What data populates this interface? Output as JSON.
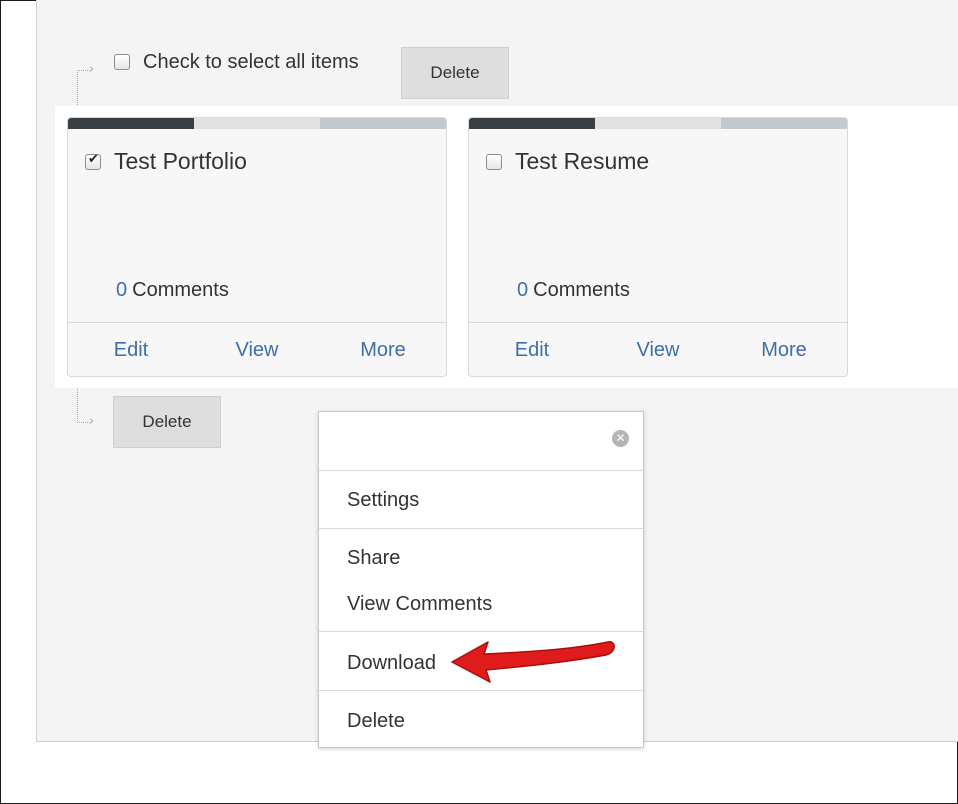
{
  "select_all": {
    "label": "Check to select all items",
    "delete_top": "Delete",
    "delete_bottom": "Delete"
  },
  "cards": [
    {
      "title": "Test Portfolio",
      "checked": true,
      "comment_count": "0",
      "comment_label": "Comments",
      "actions": {
        "edit": "Edit",
        "view": "View",
        "more": "More"
      }
    },
    {
      "title": "Test Resume",
      "checked": false,
      "comment_count": "0",
      "comment_label": "Comments",
      "actions": {
        "edit": "Edit",
        "view": "View",
        "more": "More"
      }
    }
  ],
  "context_menu": {
    "close_icon": "close-circle-icon",
    "items": [
      "Settings",
      "Share",
      "View Comments",
      "Download",
      "Delete"
    ]
  },
  "colors": {
    "link": "#3d6fa8",
    "card_bar": [
      "#3a3f44",
      "#e2e2e2",
      "#c3c9ce"
    ],
    "annotation_arrow": "#e01b1b",
    "button_bg": "#dedede"
  }
}
